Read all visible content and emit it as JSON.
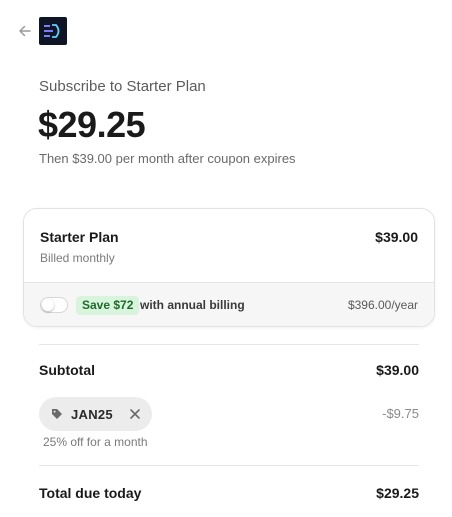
{
  "header": {
    "back_icon": "arrow-left-icon",
    "logo_icon": "brand-logo-icon"
  },
  "summary": {
    "heading": "Subscribe to Starter Plan",
    "price": "$29.25",
    "price_note": "Then $39.00 per month after coupon expires"
  },
  "plan": {
    "name": "Starter Plan",
    "billing": "Billed monthly",
    "price": "$39.00",
    "annual": {
      "toggle_on": false,
      "save_badge": "Save $72",
      "label": "with annual billing",
      "price": "$396.00/year"
    }
  },
  "totals": {
    "subtotal_label": "Subtotal",
    "subtotal_value": "$39.00",
    "coupon": {
      "code": "JAN25",
      "description": "25% off for a month",
      "discount": "-$9.75"
    },
    "total_label": "Total due today",
    "total_value": "$29.25"
  },
  "colors": {
    "save_badge_bg": "#d9f4dd",
    "save_badge_text": "#1e6b2c",
    "logo_bg": "#0f1524",
    "logo_accent": "#7b7cff"
  }
}
